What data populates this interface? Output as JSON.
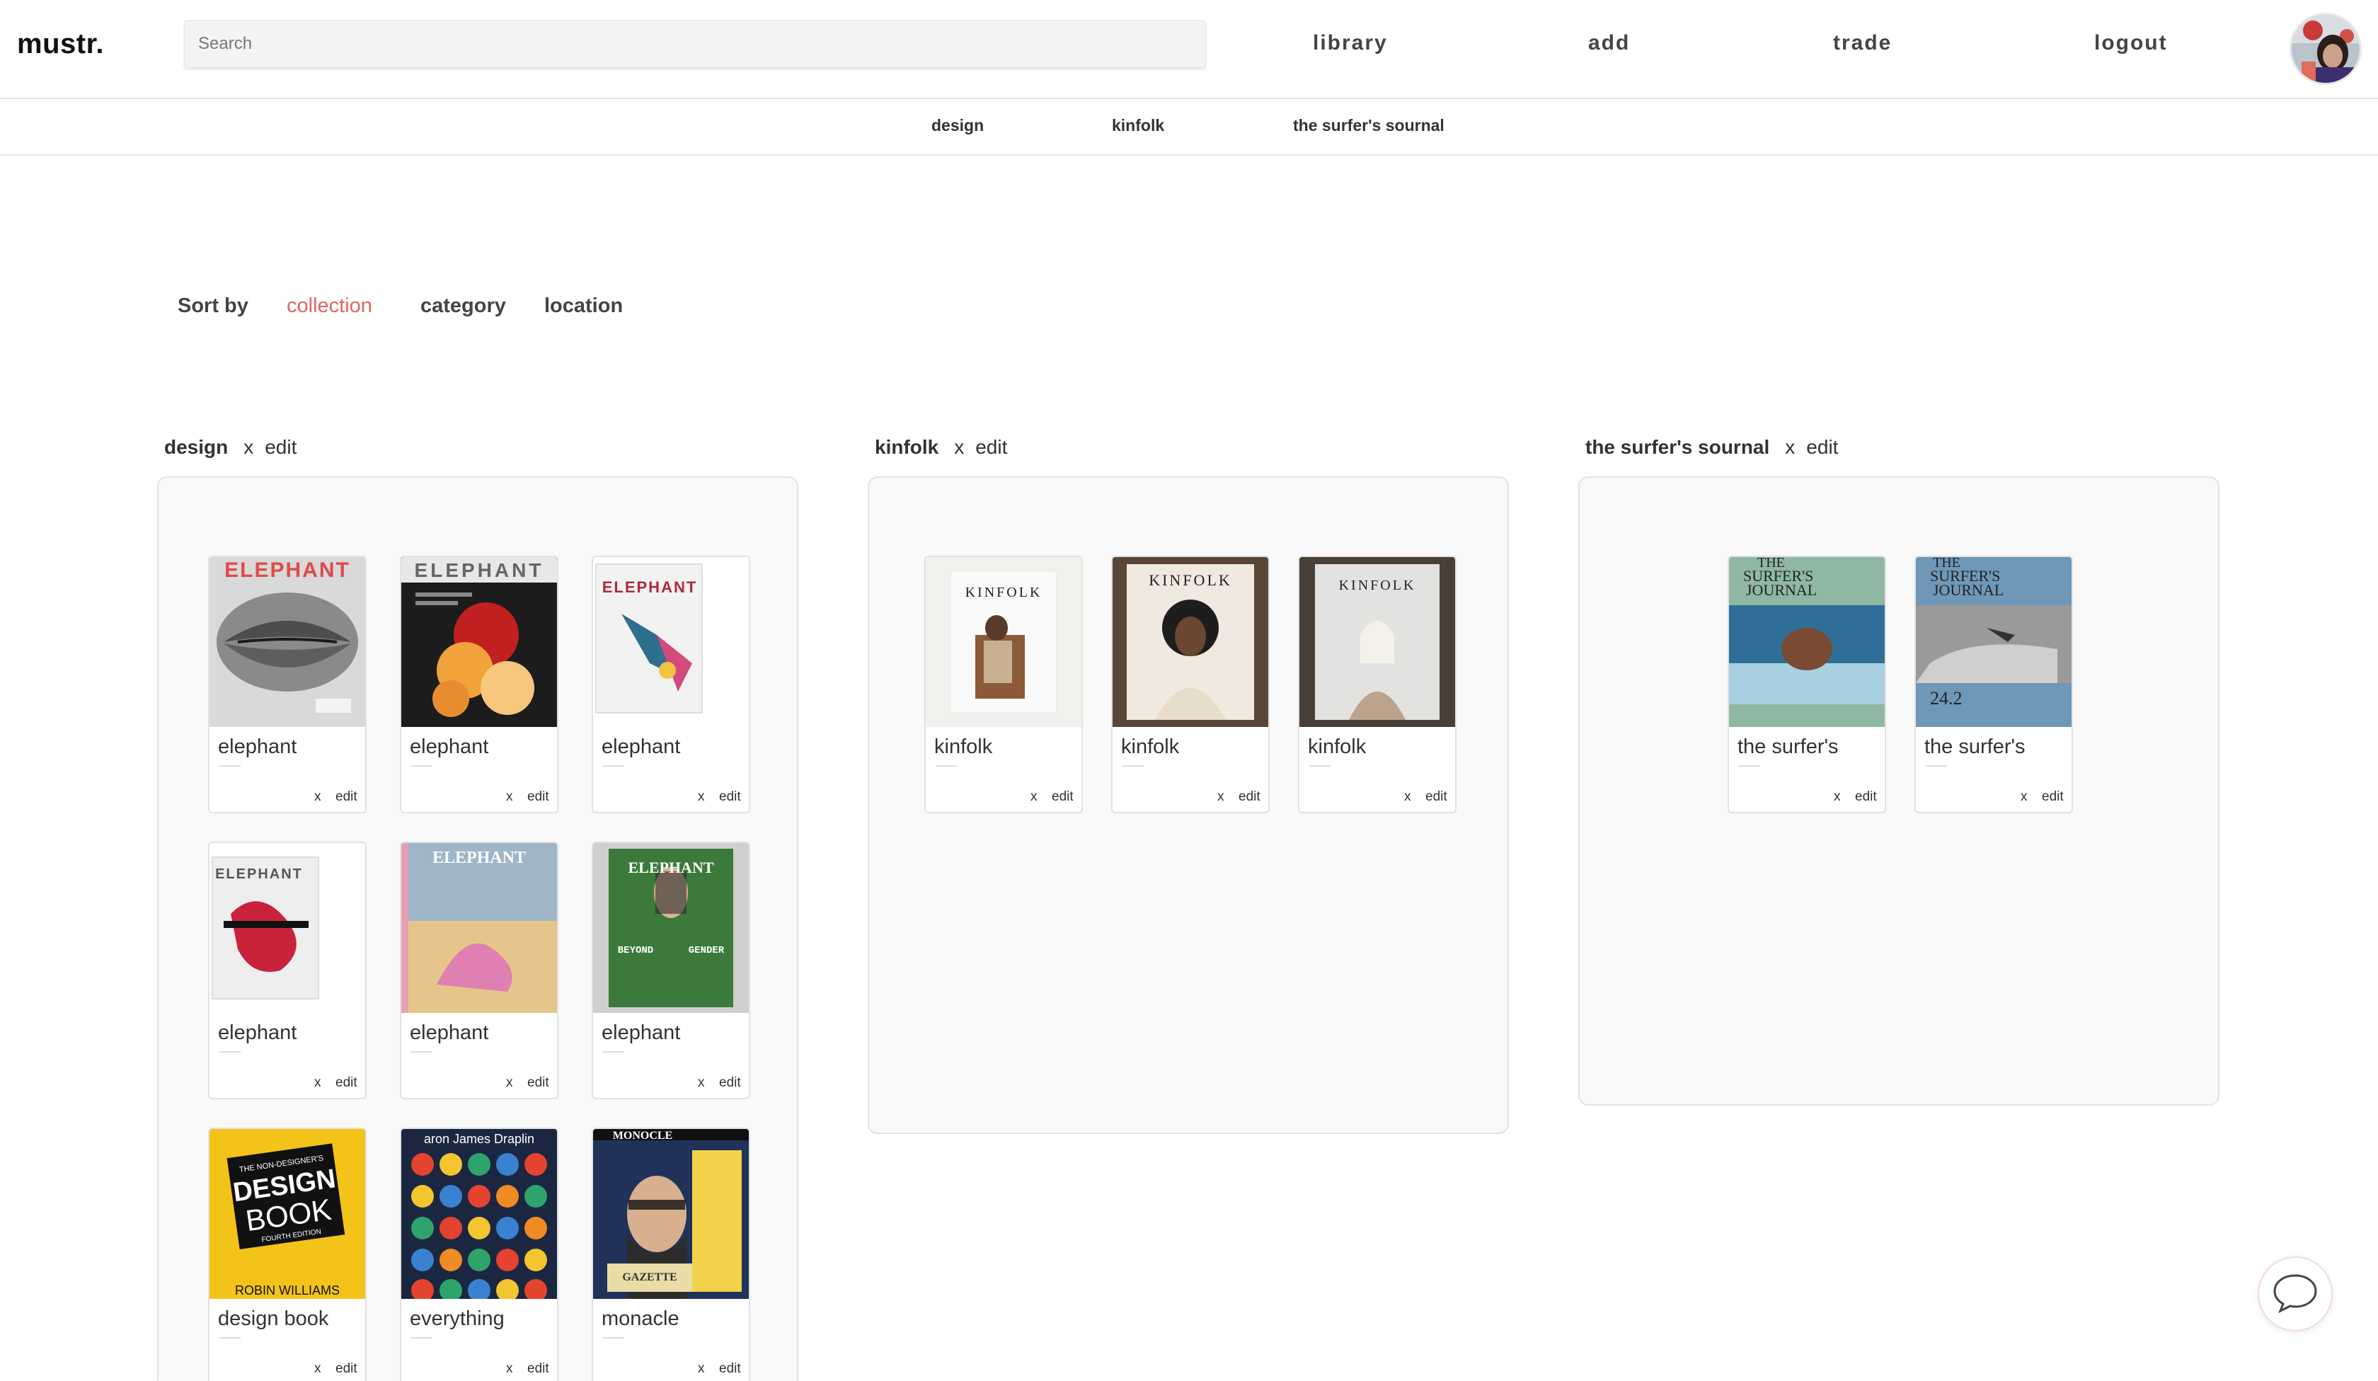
{
  "app": {
    "logo": "mustr."
  },
  "search": {
    "placeholder": "Search"
  },
  "nav": {
    "library": "library",
    "add": "add",
    "trade": "trade",
    "logout": "logout"
  },
  "subnav": {
    "items": [
      "design",
      "kinfolk",
      "the surfer's sournal"
    ]
  },
  "sort": {
    "label": "Sort by",
    "options": [
      "collection",
      "category",
      "location"
    ],
    "active": "collection"
  },
  "colors": {
    "accent": "#e06565",
    "panel": "#f9f9f9",
    "border": "#e3e3e3"
  },
  "collections": [
    {
      "name": "design",
      "x_label": "x",
      "edit_label": "edit",
      "items": [
        {
          "title": "elephant",
          "x_label": "x",
          "edit_label": "edit"
        },
        {
          "title": "elephant",
          "x_label": "x",
          "edit_label": "edit"
        },
        {
          "title": "elephant",
          "x_label": "x",
          "edit_label": "edit"
        },
        {
          "title": "elephant",
          "x_label": "x",
          "edit_label": "edit"
        },
        {
          "title": "elephant",
          "x_label": "x",
          "edit_label": "edit"
        },
        {
          "title": "elephant",
          "x_label": "x",
          "edit_label": "edit"
        },
        {
          "title": "design book",
          "x_label": "x",
          "edit_label": "edit"
        },
        {
          "title": "everything",
          "x_label": "x",
          "edit_label": "edit"
        },
        {
          "title": "monacle",
          "x_label": "x",
          "edit_label": "edit"
        }
      ]
    },
    {
      "name": "kinfolk",
      "x_label": "x",
      "edit_label": "edit",
      "items": [
        {
          "title": "kinfolk",
          "x_label": "x",
          "edit_label": "edit"
        },
        {
          "title": "kinfolk",
          "x_label": "x",
          "edit_label": "edit"
        },
        {
          "title": "kinfolk",
          "x_label": "x",
          "edit_label": "edit"
        }
      ]
    },
    {
      "name": "the surfer's sournal",
      "x_label": "x",
      "edit_label": "edit",
      "items": [
        {
          "title": "the surfer's",
          "x_label": "x",
          "edit_label": "edit"
        },
        {
          "title": "the surfer's",
          "x_label": "x",
          "edit_label": "edit"
        }
      ]
    }
  ],
  "covers": {
    "elephant_masthead": "ELEPHANT",
    "kinfolk_masthead": "KINFOLK",
    "surfers_masthead_1": "THE",
    "surfers_masthead_2": "SURFER'S",
    "surfers_masthead_3": "JOURNAL",
    "surfers_issue": "24.2",
    "design_book_line1": "THE NON-DESIGNER'S",
    "design_book_line2": "DESIGN",
    "design_book_line3": "BOOK",
    "design_book_line4": "FOURTH EDITION",
    "design_book_author": "ROBIN WILLIAMS",
    "everything_author": "aron James Draplin",
    "monocle_masthead": "MONOCLE",
    "monocle_gazette": "GAZETTE",
    "elephant_beyond": "BEYOND",
    "elephant_gender": "GENDER"
  },
  "icons": {
    "chat": "chat-bubble-icon",
    "avatar": "user-avatar"
  }
}
